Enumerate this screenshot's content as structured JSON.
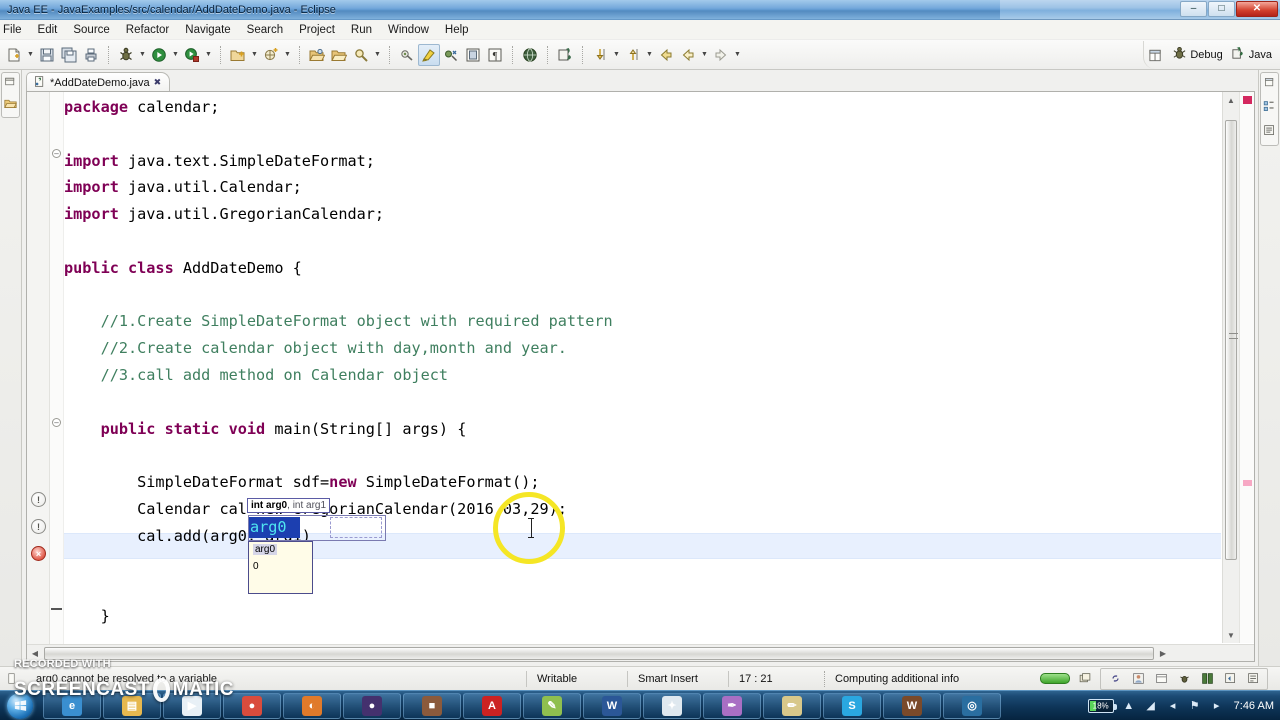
{
  "window": {
    "title": "Java EE - JavaExamples/src/calendar/AddDateDemo.java - Eclipse",
    "minimize_label": "–",
    "maximize_label": "□",
    "close_label": "✕"
  },
  "menu": {
    "items": [
      {
        "label": "File"
      },
      {
        "label": "Edit"
      },
      {
        "label": "Source"
      },
      {
        "label": "Refactor"
      },
      {
        "label": "Navigate"
      },
      {
        "label": "Search"
      },
      {
        "label": "Project"
      },
      {
        "label": "Run"
      },
      {
        "label": "Window"
      },
      {
        "label": "Help"
      }
    ]
  },
  "toolbar": {
    "groups": [
      {
        "buttons": [
          {
            "icon": "new-file-icon",
            "arrow": true
          },
          {
            "icon": "save-icon",
            "arrow": false
          },
          {
            "icon": "save-all-icon",
            "arrow": false
          },
          {
            "icon": "print-icon",
            "arrow": false
          }
        ]
      },
      {
        "buttons": [
          {
            "icon": "debug-icon",
            "arrow": true
          },
          {
            "icon": "run-icon",
            "arrow": true
          },
          {
            "icon": "run-external-tools-icon",
            "arrow": true
          }
        ]
      },
      {
        "buttons": [
          {
            "icon": "new-java-project-icon",
            "arrow": true
          },
          {
            "icon": "new-package-icon",
            "arrow": true
          }
        ]
      },
      {
        "buttons": [
          {
            "icon": "open-type-icon",
            "arrow": false
          },
          {
            "icon": "open-task-icon",
            "arrow": false
          },
          {
            "icon": "search-ref-icon",
            "arrow": true
          }
        ]
      },
      {
        "buttons": [
          {
            "icon": "toggle-marker-icon",
            "arrow": false
          },
          {
            "icon": "toggle-highlight-icon",
            "arrow": false,
            "pressed": true
          },
          {
            "icon": "skip-breakpoints-icon",
            "arrow": false
          },
          {
            "icon": "block-selection-icon",
            "arrow": false
          },
          {
            "icon": "whitespace-icon",
            "arrow": false
          }
        ]
      },
      {
        "buttons": [
          {
            "icon": "web-browser-icon",
            "arrow": false
          }
        ]
      },
      {
        "buttons": [
          {
            "icon": "open-perspective-icon",
            "arrow": false
          }
        ]
      },
      {
        "buttons": [
          {
            "icon": "next-annotation-icon",
            "arrow": true
          },
          {
            "icon": "previous-annotation-icon",
            "arrow": true
          },
          {
            "icon": "back-icon",
            "arrow": false
          },
          {
            "icon": "back-history-icon",
            "arrow": true
          },
          {
            "icon": "forward-icon",
            "arrow": true
          }
        ]
      }
    ]
  },
  "perspectives": {
    "open_label": "",
    "items": [
      {
        "label": "Debug",
        "icon": "debug-perspective-icon"
      },
      {
        "label": "Java",
        "icon": "java-perspective-icon"
      }
    ]
  },
  "editor": {
    "tab": {
      "label": "*AddDateDemo.java",
      "icon": "java-file-icon",
      "close_label": "✖"
    },
    "code_lines": [
      {
        "indent": 0,
        "parts": [
          {
            "t": "package",
            "c": "kw"
          },
          {
            "t": " calendar;",
            "c": ""
          }
        ]
      },
      {
        "indent": 0,
        "parts": []
      },
      {
        "indent": 0,
        "parts": [
          {
            "t": "import",
            "c": "kw"
          },
          {
            "t": " java.text.SimpleDateFormat;",
            "c": ""
          }
        ]
      },
      {
        "indent": 0,
        "parts": [
          {
            "t": "import",
            "c": "kw"
          },
          {
            "t": " java.util.Calendar;",
            "c": ""
          }
        ]
      },
      {
        "indent": 0,
        "parts": [
          {
            "t": "import",
            "c": "kw"
          },
          {
            "t": " java.util.GregorianCalendar;",
            "c": ""
          }
        ]
      },
      {
        "indent": 0,
        "parts": []
      },
      {
        "indent": 0,
        "parts": [
          {
            "t": "public class",
            "c": "kw"
          },
          {
            "t": " AddDateDemo {",
            "c": ""
          }
        ]
      },
      {
        "indent": 0,
        "parts": []
      },
      {
        "indent": 1,
        "parts": [
          {
            "t": "//1.Create SimpleDateFormat object with required pattern",
            "c": "cmt"
          }
        ]
      },
      {
        "indent": 1,
        "parts": [
          {
            "t": "//2.Create calendar object with day,month and year.",
            "c": "cmt"
          }
        ]
      },
      {
        "indent": 1,
        "parts": [
          {
            "t": "//3.call add method on Calendar object",
            "c": "cmt"
          }
        ]
      },
      {
        "indent": 0,
        "parts": []
      },
      {
        "indent": 1,
        "parts": [
          {
            "t": "public static void",
            "c": "kw"
          },
          {
            "t": " main(String[] args) {",
            "c": ""
          }
        ]
      },
      {
        "indent": 0,
        "parts": []
      },
      {
        "indent": 2,
        "parts": [
          {
            "t": "SimpleDateFormat sdf=",
            "c": ""
          },
          {
            "t": "new",
            "c": "kw"
          },
          {
            "t": " SimpleDateFormat();",
            "c": ""
          }
        ]
      },
      {
        "indent": 2,
        "parts": [
          {
            "t": "Calendar cal=new GregorianCalendar(2016,03,29);",
            "c": ""
          }
        ]
      },
      {
        "indent": 2,
        "parts": [
          {
            "t": "cal.add(arg0, arg1)",
            "c": ""
          }
        ]
      },
      {
        "indent": 0,
        "parts": []
      },
      {
        "indent": 0,
        "parts": []
      },
      {
        "indent": 1,
        "parts": [
          {
            "t": "}",
            "c": ""
          }
        ]
      }
    ],
    "annotations": [
      {
        "type": "warning",
        "glyph": "!"
      },
      {
        "type": "warning",
        "glyph": "!"
      },
      {
        "type": "error",
        "glyph": "×"
      }
    ],
    "signature_tooltip": {
      "param0": "int arg0",
      "separator": ", ",
      "param1": "int arg1"
    },
    "selected_arg": "arg0",
    "second_arg": "arg1",
    "hover_popup": {
      "name": "arg0",
      "value": "0"
    }
  },
  "status_bar": {
    "error_message": "arg0 cannot be resolved to a variable",
    "writable": "Writable",
    "insert_mode": "Smart Insert",
    "cursor_position": "17 : 21",
    "task_message": "Computing additional info"
  },
  "watermark": {
    "line1": "RECORDED WITH",
    "line2a": "SCREENCAST",
    "line2b": "MATIC"
  },
  "taskbar": {
    "items": [
      {
        "name": "internet-explorer",
        "glyph": "e",
        "color": "#3a8fd0"
      },
      {
        "name": "file-explorer",
        "glyph": "▤",
        "color": "#e6b84f"
      },
      {
        "name": "media-player",
        "glyph": "▶",
        "color": "#e8f0f6"
      },
      {
        "name": "google-chrome",
        "glyph": "●",
        "color": "#d94c3d"
      },
      {
        "name": "mozilla-firefox",
        "glyph": "◐",
        "color": "#e07a2a"
      },
      {
        "name": "eclipse-ide",
        "glyph": "●",
        "color": "#44316e"
      },
      {
        "name": "archive-manager",
        "glyph": "■",
        "color": "#8b5a3c"
      },
      {
        "name": "adobe-reader",
        "glyph": "A",
        "color": "#cc2222"
      },
      {
        "name": "notepad-plus",
        "glyph": "✎",
        "color": "#8fbf4f"
      },
      {
        "name": "microsoft-word",
        "glyph": "W",
        "color": "#2b5797"
      },
      {
        "name": "satellite-app",
        "glyph": "✦",
        "color": "#dfe8ef"
      },
      {
        "name": "paint-app",
        "glyph": "✒",
        "color": "#a96fc4"
      },
      {
        "name": "editor-app",
        "glyph": "✏",
        "color": "#d8c88a"
      },
      {
        "name": "skype",
        "glyph": "S",
        "color": "#2aa7e0"
      },
      {
        "name": "wampserver",
        "glyph": "W",
        "color": "#7a4a2a"
      },
      {
        "name": "media-app",
        "glyph": "◎",
        "color": "#2a6ea0"
      }
    ],
    "battery_percent": "18%",
    "clock": "7:46 AM",
    "tray_icons": [
      {
        "name": "show-hidden-icons",
        "glyph": "▲"
      },
      {
        "name": "network-icon",
        "glyph": "◢"
      },
      {
        "name": "speaker-icon",
        "glyph": "◂"
      },
      {
        "name": "action-center-icon",
        "glyph": "⚑"
      },
      {
        "name": "volume-icon",
        "glyph": "▸"
      }
    ]
  }
}
